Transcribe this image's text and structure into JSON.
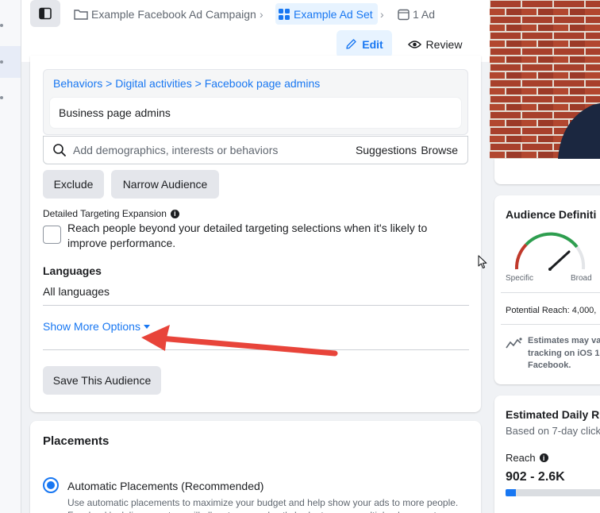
{
  "breadcrumb": {
    "campaign": "Example Facebook Ad Campaign",
    "adset": "Example Ad Set",
    "ad": "1 Ad"
  },
  "actions": {
    "edit": "Edit",
    "review": "Review"
  },
  "targeting": {
    "path": [
      "Behaviors",
      "Digital activities",
      "Facebook page admins"
    ],
    "path_sep": ">",
    "selected_item": "Business page admins",
    "search_placeholder": "Add demographics, interests or behaviors",
    "suggestions": "Suggestions",
    "browse": "Browse",
    "exclude": "Exclude",
    "narrow": "Narrow Audience"
  },
  "expansion": {
    "label": "Detailed Targeting Expansion",
    "text": "Reach people beyond your detailed targeting selections when it's likely to improve performance.",
    "checked": false
  },
  "languages": {
    "heading": "Languages",
    "value": "All languages"
  },
  "show_more": "Show More Options",
  "save_audience": "Save This Audience",
  "placements": {
    "title": "Placements",
    "option": "Automatic Placements (Recommended)",
    "description": "Use automatic placements to maximize your budget and help show your ads to more people. Facebook's delivery system will allocate your ad set's budget across multiple placements based",
    "selected": true
  },
  "audience_definition": {
    "title": "Audience Definiti",
    "specific": "Specific",
    "broad": "Broad",
    "potential_reach": "Potential Reach: 4,000,",
    "note_lines": [
      "Estimates may va",
      "tracking on iOS 1-",
      "Facebook."
    ]
  },
  "daily_results": {
    "title": "Estimated Daily R",
    "subtitle": "Based on 7-day click",
    "reach_label": "Reach",
    "reach_value": "902 - 2.6K",
    "reach_fill_fraction": 0.1
  },
  "colors": {
    "accent": "#1877f2",
    "arrow": "#e8443a",
    "gauge_green": "#2e9e4f",
    "gauge_red": "#c0392b"
  }
}
